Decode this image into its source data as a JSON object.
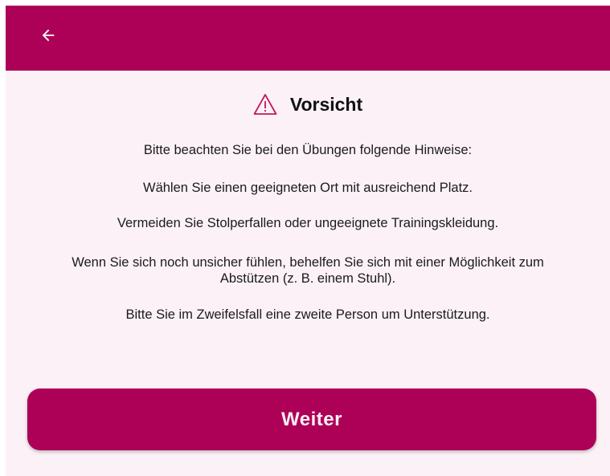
{
  "appbar": {
    "back_icon": "arrow-left-icon",
    "color": "#ad0057"
  },
  "dialog": {
    "title": "Vorsicht",
    "title_icon": "warning-triangle-icon",
    "intro": "Bitte beachten Sie bei den Übungen folgende Hinweise:",
    "hints": [
      "Wählen Sie einen geeigneten Ort mit ausreichend Platz.",
      "Vermeiden Sie Stolperfallen oder ungeeignete Trainingskleidung.",
      "Wenn Sie sich noch unsicher fühlen, behelfen Sie sich mit einer Möglichkeit zum Abstützen (z. B. einem Stuhl).",
      "Bitte Sie im Zweifelsfall eine zweite Person um Unterstützung."
    ]
  },
  "actions": {
    "continue_label": "Weiter"
  },
  "colors": {
    "accent": "#ad0057",
    "background": "#fbf1f6",
    "warning_icon": "#c2185b"
  }
}
